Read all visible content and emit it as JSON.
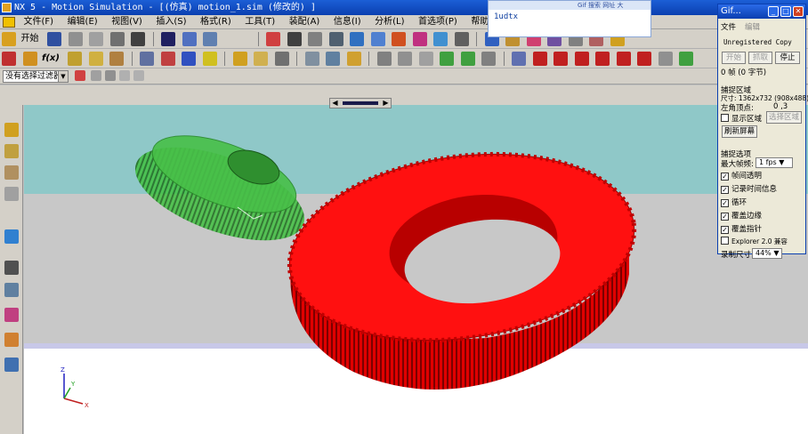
{
  "window": {
    "title": "NX 5 - Motion Simulation - [(仿真) motion_1.sim (修改的) ]"
  },
  "menu": {
    "items": [
      "文件(F)",
      "编辑(E)",
      "视图(V)",
      "插入(S)",
      "格式(R)",
      "工具(T)",
      "装配(A)",
      "信息(I)",
      "分析(L)",
      "首选项(P)",
      "帮助(H)"
    ]
  },
  "toolbar": {
    "start_label": "开始",
    "fx_label": "f(x)"
  },
  "filter": {
    "selected": "没有选择过滤器"
  },
  "popup": {
    "tabs": "Gif 搜索   网址 大",
    "text": "1udtx"
  },
  "gif_window": {
    "title": "Gif...",
    "menu_file": "文件",
    "menu_edit": "编辑",
    "unregistered": "Unregistered Copy",
    "btn_start": "开始",
    "btn_capture": "抓取",
    "btn_stop": "停止",
    "frames": "0 帧 (0 字节)",
    "capture_area_header": "捕捉区域",
    "size_label": "尺寸: 1362x732 (908x488)",
    "origin_label": "左角顶点:",
    "origin_value": "0 ,3",
    "show_area": "显示区域",
    "select_area": "选择区域",
    "refresh": "刷新屏幕",
    "capture_options_header": "捕捉选项",
    "max_fps_label": "最大帧频:",
    "max_fps_value": "1 fps",
    "opt_transparent": "帧间透明",
    "opt_record_time": "记录时间信息",
    "opt_loop": "循环",
    "opt_cover_border": "覆盖边缘",
    "opt_cover_cursor": "覆盖指针",
    "opt_explorer": "Explorer 2.0 兼容",
    "record_size_label": "录制尺寸",
    "record_size_value": "44%"
  },
  "viewport": {
    "triad_x": "X",
    "triad_y": "Y",
    "triad_z": "Z"
  },
  "colors": {
    "large_gear": "#ff1010",
    "small_gear": "#3cb83c",
    "bg_teal": "#8fc8c8",
    "bg_gray": "#c8c8c8",
    "bg_lavender": "#c8c8e8"
  }
}
